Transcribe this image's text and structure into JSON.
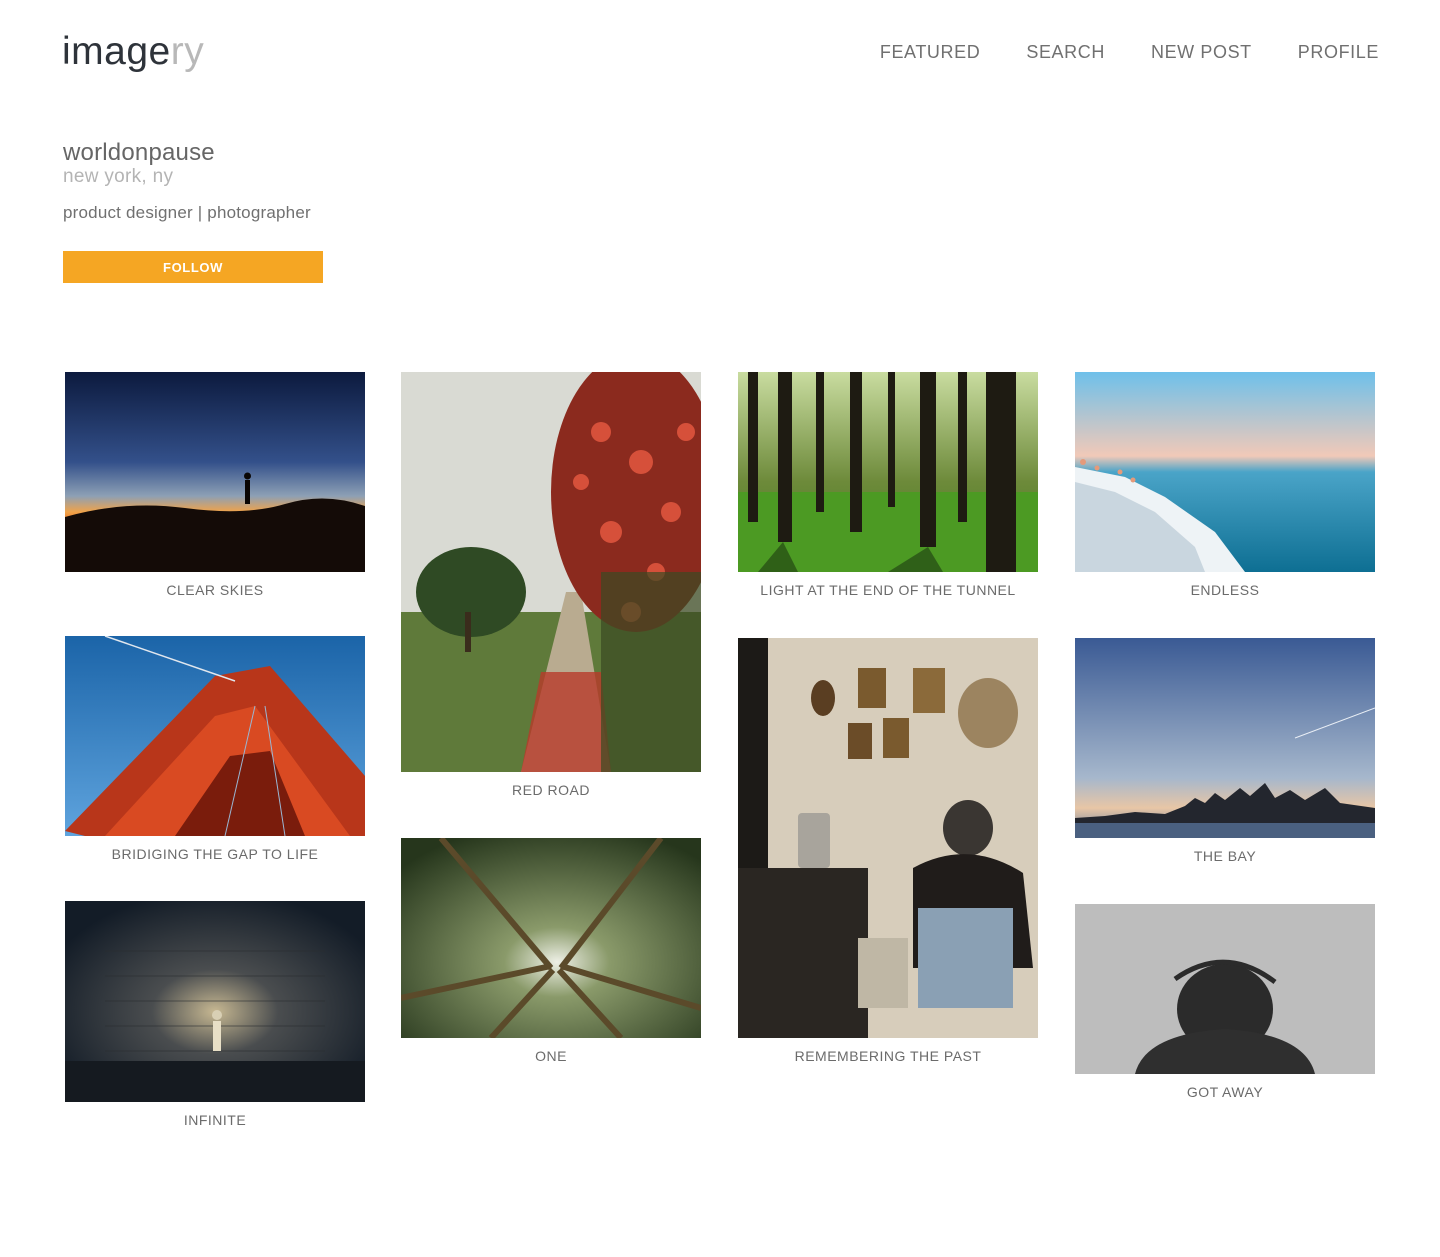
{
  "brand": {
    "main": "image",
    "faded": "ry"
  },
  "nav": [
    "FEATURED",
    "SEARCH",
    "NEW POST",
    "PROFILE"
  ],
  "profile": {
    "username": "worldonpause",
    "location": "new york, ny",
    "bio": "product designer | photographer",
    "follow_label": "FOLLOW",
    "follow_color": "#f5a623"
  },
  "photos": [
    {
      "title": "CLEAR SKIES"
    },
    {
      "title": "BRIDIGING THE GAP TO LIFE"
    },
    {
      "title": "INFINITE"
    },
    {
      "title": "RED ROAD"
    },
    {
      "title": "ONE"
    },
    {
      "title": "LIGHT AT THE END OF THE TUNNEL"
    },
    {
      "title": "REMEMBERING THE PAST"
    },
    {
      "title": "ENDLESS"
    },
    {
      "title": "THE BAY"
    },
    {
      "title": "GOT AWAY"
    }
  ]
}
